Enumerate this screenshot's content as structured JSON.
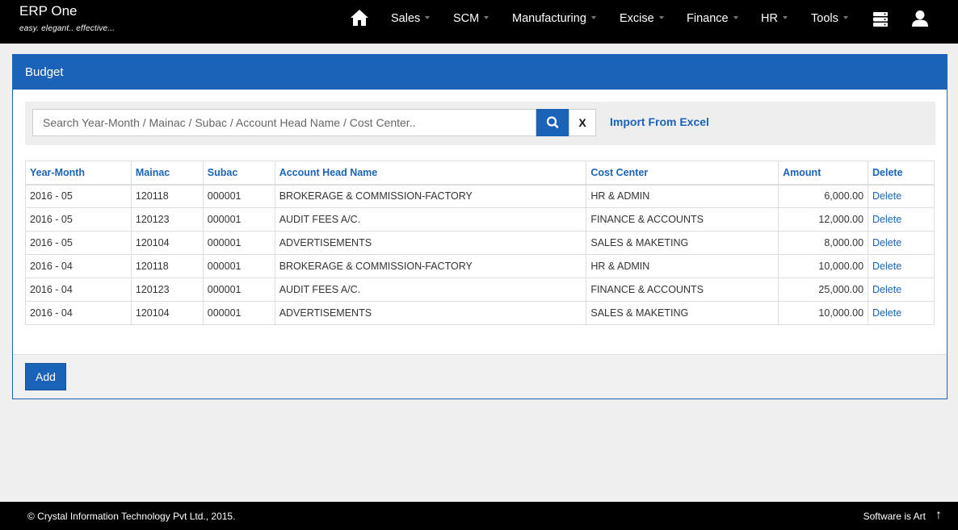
{
  "app": {
    "name": "ERP One",
    "tagline": "easy. elegant.. effective..."
  },
  "nav": {
    "home_icon": "home-icon",
    "items": [
      {
        "label": "Sales"
      },
      {
        "label": "SCM"
      },
      {
        "label": "Manufacturing"
      },
      {
        "label": "Excise"
      },
      {
        "label": "Finance"
      },
      {
        "label": "HR"
      },
      {
        "label": "Tools"
      }
    ],
    "database_icon": "database-icon",
    "user_icon": "user-icon"
  },
  "panel": {
    "title": "Budget"
  },
  "search": {
    "value": "",
    "placeholder": "Search Year-Month / Mainac / Subac / Account Head Name / Cost Center..",
    "search_icon": "search-icon",
    "clear_label": "X",
    "import_label": "Import From Excel"
  },
  "table": {
    "headers": [
      "Year-Month",
      "Mainac",
      "Subac",
      "Account Head Name",
      "Cost Center",
      "Amount",
      "Delete"
    ],
    "rows": [
      [
        "2016 - 05",
        "120118",
        "000001",
        "BROKERAGE & COMMISSION-FACTORY",
        "HR & ADMIN",
        "6,000.00",
        "Delete"
      ],
      [
        "2016 - 05",
        "120123",
        "000001",
        "AUDIT FEES A/C.",
        "FINANCE & ACCOUNTS",
        "12,000.00",
        "Delete"
      ],
      [
        "2016 - 05",
        "120104",
        "000001",
        "ADVERTISEMENTS",
        "SALES & MAKETING",
        "8,000.00",
        "Delete"
      ],
      [
        "2016 - 04",
        "120118",
        "000001",
        "BROKERAGE & COMMISSION-FACTORY",
        "HR & ADMIN",
        "10,000.00",
        "Delete"
      ],
      [
        "2016 - 04",
        "120123",
        "000001",
        "AUDIT FEES A/C.",
        "FINANCE & ACCOUNTS",
        "25,000.00",
        "Delete"
      ],
      [
        "2016 - 04",
        "120104",
        "000001",
        "ADVERTISEMENTS",
        "SALES & MAKETING",
        "10,000.00",
        "Delete"
      ]
    ]
  },
  "actions": {
    "add_label": "Add"
  },
  "footer": {
    "copyright": "© Crystal Information Technology Pvt Ltd., 2015.",
    "motto": "Software is Art",
    "up_icon": "arrow-up-icon"
  },
  "colors": {
    "primary": "#1a63b8",
    "navbar": "#000000",
    "background": "#efefef"
  }
}
